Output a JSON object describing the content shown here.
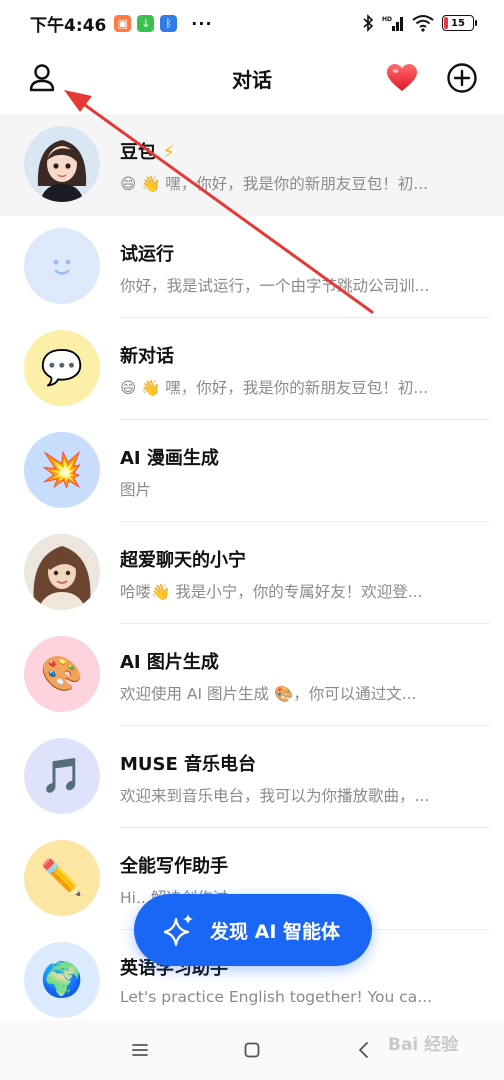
{
  "status_bar": {
    "time": "下午4:46",
    "dots": "···",
    "battery": "15"
  },
  "header": {
    "title": "对话"
  },
  "chats": [
    {
      "name": "豆包",
      "name_badge": "⚡",
      "preview": "😄 👋 嘿，你好，我是你的新朋友豆包！初...",
      "avatar_icon": "girl-portrait"
    },
    {
      "name": "试运行",
      "preview": "你好，我是试运行，一个由字节跳动公司训...",
      "avatar_icon": "smiley-face"
    },
    {
      "name": "新对话",
      "preview": "😄 👋 嘿，你好，我是你的新朋友豆包！初...",
      "avatar_icon": "speech-bubble",
      "avatar_glyph": "💬"
    },
    {
      "name": "AI 漫画生成",
      "preview": "图片",
      "avatar_icon": "collision",
      "avatar_glyph": "💥"
    },
    {
      "name": "超爱聊天的小宁",
      "preview": "哈喽👋 我是小宁，你的专属好友！欢迎登...",
      "avatar_icon": "woman-portrait"
    },
    {
      "name": "AI 图片生成",
      "preview": "欢迎使用 AI 图片生成 🎨，你可以通过文...",
      "avatar_icon": "palette",
      "avatar_glyph": "🎨"
    },
    {
      "name": "MUSE 音乐电台",
      "preview": "欢迎来到音乐电台，我可以为你播放歌曲，...",
      "avatar_icon": "music-note",
      "avatar_glyph": "🎵"
    },
    {
      "name": "全能写作助手",
      "preview": "Hi...解决创作过...",
      "avatar_icon": "pencil",
      "avatar_glyph": "✏️"
    },
    {
      "name": "英语学习助手",
      "preview": "Let's practice English together! You ca...",
      "avatar_icon": "globe",
      "avatar_glyph": "🌍"
    }
  ],
  "fab": {
    "label": "发现 AI 智能体",
    "icon": "sparkle-icon"
  },
  "watermark": "Bai 经验",
  "colors": {
    "accent": "#1a66f5",
    "selected_row": "#f5f5f6",
    "preview_text": "#8a8a8f",
    "annotation_arrow": "#e53935"
  }
}
